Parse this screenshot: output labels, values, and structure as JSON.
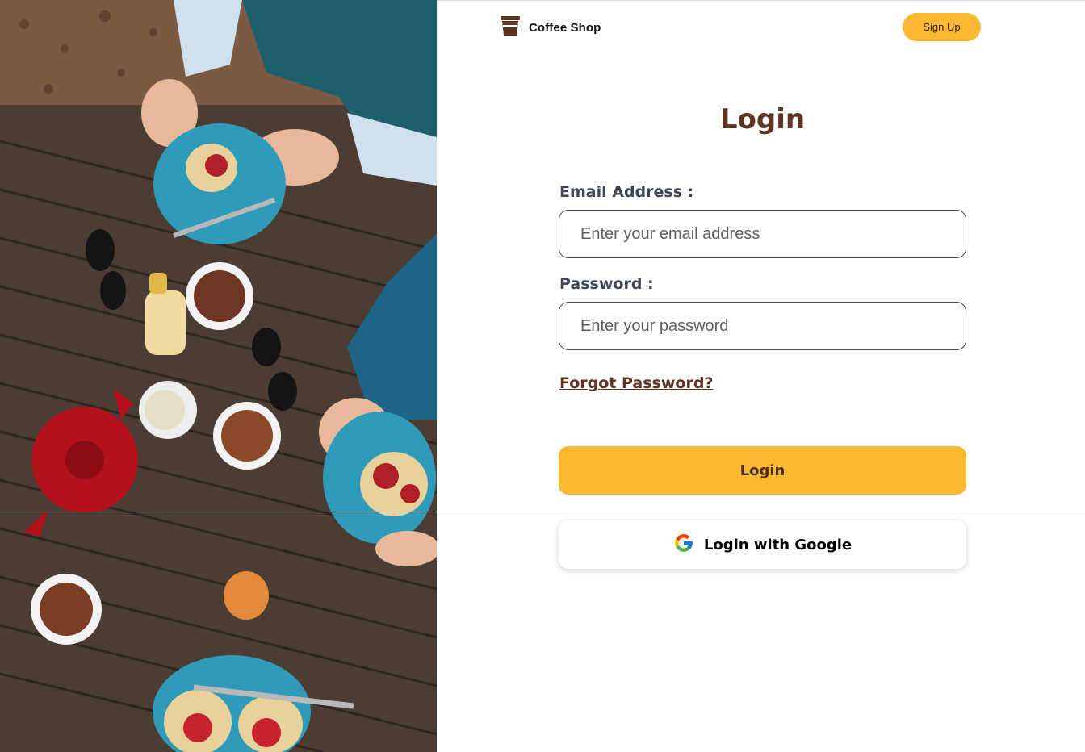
{
  "brand": {
    "name": "Coffee Shop",
    "icon": "coffee-cup-icon"
  },
  "header": {
    "signup_label": "Sign Up"
  },
  "form": {
    "title": "Login",
    "email_label": "Email Address :",
    "email_placeholder": "Enter your email address",
    "email_value": "",
    "password_label": "Password :",
    "password_placeholder": "Enter your password",
    "password_value": "",
    "forgot_label": "Forgot Password?",
    "login_label": "Login",
    "google_label": "Login with Google",
    "google_icon": "google-g-icon"
  },
  "colors": {
    "accent": "#fbb833",
    "brand_brown": "#5e3423",
    "label_gray": "#3f4652"
  },
  "photo": {
    "subject": "overhead view of tea, scones with jam and teapot on wooden table",
    "icon": "hero-photo"
  }
}
